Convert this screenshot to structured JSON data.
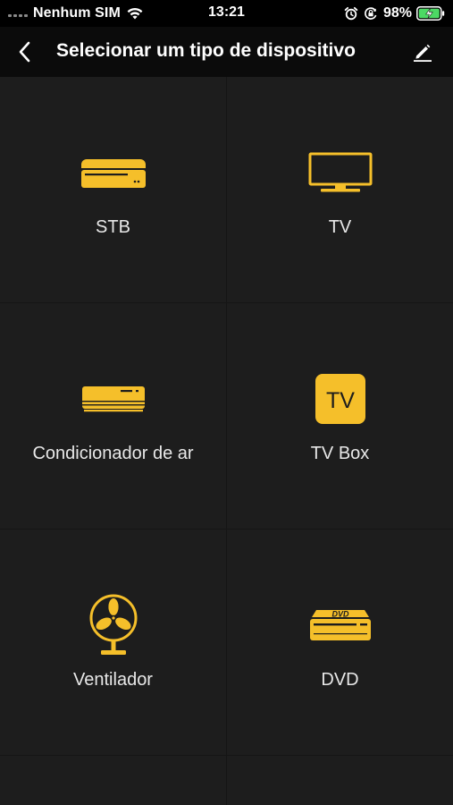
{
  "status_bar": {
    "carrier": "Nenhum SIM",
    "time": "13:21",
    "battery_percent": "98%",
    "icons": [
      "signal-dots-icon",
      "wifi-icon",
      "alarm-icon",
      "orientation-lock-icon",
      "battery-charging-icon"
    ]
  },
  "nav": {
    "title": "Selecionar um tipo de dispositivo",
    "back_icon": "chevron-left-icon",
    "edit_icon": "pencil-icon"
  },
  "theme": {
    "accent": "#F5BF2A",
    "background": "#1D1D1D",
    "text": "#E8E8E8"
  },
  "devices": [
    {
      "label": "STB",
      "icon": "set-top-box-icon"
    },
    {
      "label": "TV",
      "icon": "tv-icon"
    },
    {
      "label": "Condicionador de ar",
      "icon": "air-conditioner-icon"
    },
    {
      "label": "TV Box",
      "icon": "tv-box-icon",
      "icon_text": "TV"
    },
    {
      "label": "Ventilador",
      "icon": "fan-icon"
    },
    {
      "label": "DVD",
      "icon": "dvd-player-icon",
      "icon_text": "DVD"
    }
  ]
}
